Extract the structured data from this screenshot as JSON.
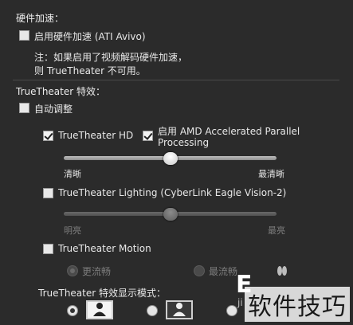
{
  "hw_accel": {
    "title": "硬件加速：",
    "enable_label": "启用硬件加速 (ATI Avivo)",
    "enable_checked": false,
    "note_line1": "注：如果启用了视频解码硬件加速，",
    "note_line2": "则 TrueTheater 不可用。"
  },
  "truetheater": {
    "title": "TrueTheater 特效：",
    "auto_adjust_label": "自动调整",
    "auto_adjust_checked": false,
    "hd": {
      "label": "TrueTheater HD",
      "checked": true,
      "amd_label_line1": "启用 AMD Accelerated Parallel",
      "amd_label_line2": "Processing",
      "amd_checked": true,
      "slider_value": 0.5,
      "min_label": "清晰",
      "max_label": "最清晰"
    },
    "lighting": {
      "label": "TrueTheater Lighting (CyberLink Eagle Vision-2)",
      "checked": false,
      "slider_value": 0.5,
      "min_label": "明亮",
      "max_label": "最亮"
    },
    "motion": {
      "label": "TrueTheater Motion",
      "checked": false,
      "option1": "更流畅",
      "option2": "最流畅"
    },
    "display_mode": {
      "title": "TrueTheater 特效显示模式："
    }
  },
  "watermark": {
    "big_letter": "E",
    "small_text": "ji",
    "text": "软件技巧"
  },
  "colors": {
    "background": "#2b2b2b",
    "text": "#e4e4e4",
    "disabled_text": "#7c7c7c"
  }
}
